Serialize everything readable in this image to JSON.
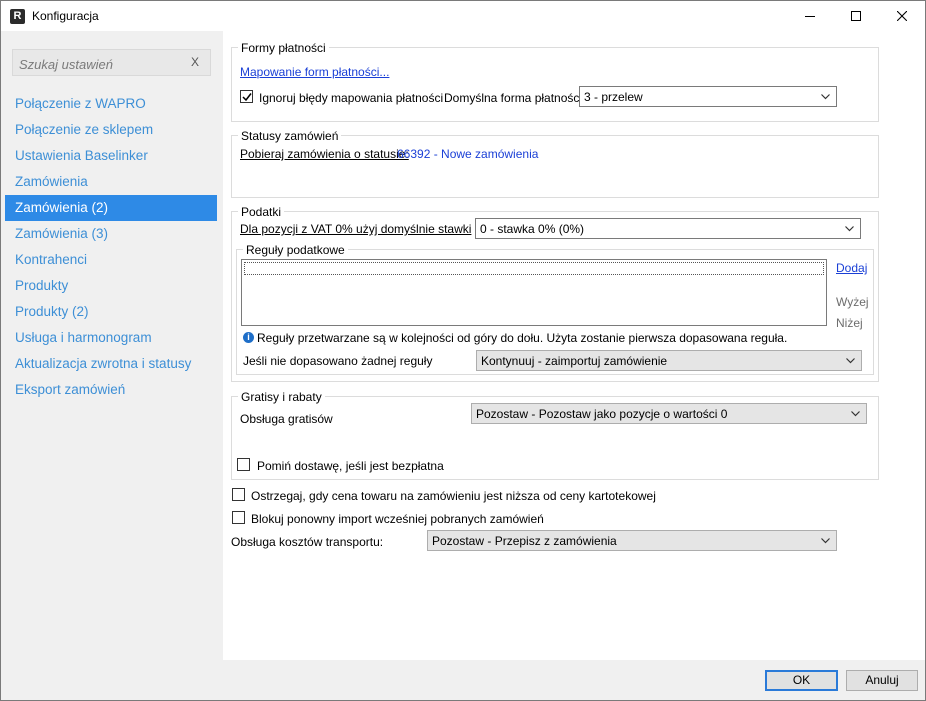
{
  "window": {
    "title": "Konfiguracja",
    "app_icon_letter": "R"
  },
  "sidebar": {
    "search_placeholder": "Szukaj ustawień",
    "search_clear": "X",
    "items": [
      {
        "label": "Połączenie z WAPRO"
      },
      {
        "label": "Połączenie ze sklepem"
      },
      {
        "label": "Ustawienia Baselinker"
      },
      {
        "label": "Zamówienia"
      },
      {
        "label": "Zamówienia (2)",
        "active": true
      },
      {
        "label": "Zamówienia (3)"
      },
      {
        "label": "Kontrahenci"
      },
      {
        "label": "Produkty"
      },
      {
        "label": "Produkty (2)"
      },
      {
        "label": "Usługa i harmonogram"
      },
      {
        "label": "Aktualizacja zwrotna i statusy"
      },
      {
        "label": "Eksport zamówień"
      }
    ]
  },
  "payment": {
    "title": "Formy płatności",
    "mapping_link": "Mapowanie form płatności...",
    "ignore_errors_label": "Ignoruj błędy mapowania płatności",
    "ignore_errors_checked": true,
    "default_label": "Domyślna forma płatności:",
    "default_value": "3 - przelew"
  },
  "statuses": {
    "title": "Statusy zamówień",
    "fetch_label": "Pobieraj zamówienia o statusie:",
    "fetch_value": "66392 - Nowe zamówienia"
  },
  "taxes": {
    "title": "Podatki",
    "vat_label": "Dla pozycji z VAT 0% użyj domyślnie stawki",
    "vat_value": "0 - stawka 0% (0%)",
    "rules_title": "Reguły podatkowe",
    "add_link": "Dodaj",
    "up_label": "Wyżej",
    "down_label": "Niżej",
    "info_text": "Reguły przetwarzane są w kolejności od góry do dołu. Użyta zostanie pierwsza dopasowana reguła.",
    "no_match_label": "Jeśli nie dopasowano żadnej reguły",
    "no_match_value": "Kontynuuj - zaimportuj zamówienie"
  },
  "gifts": {
    "title": "Gratisy i rabaty",
    "handling_label": "Obsługa gratisów",
    "handling_value": "Pozostaw - Pozostaw jako pozycje o wartości 0",
    "skip_delivery_label": "Pomiń dostawę, jeśli jest bezpłatna",
    "skip_delivery_checked": false
  },
  "options": {
    "warn_price_label": "Ostrzegaj, gdy cena towaru na zamówieniu jest niższa od ceny kartotekowej",
    "block_reimport_label": "Blokuj ponowny import wcześniej pobranych zamówień",
    "transport_label": "Obsługa kosztów transportu:",
    "transport_value": "Pozostaw - Przepisz z zamówienia"
  },
  "footer": {
    "ok_label": "OK",
    "cancel_label": "Anuluj"
  }
}
